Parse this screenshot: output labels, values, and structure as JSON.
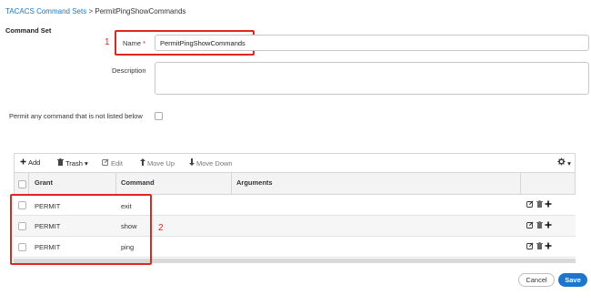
{
  "breadcrumb": {
    "link": "TACACS Command Sets",
    "separator": ">",
    "current": "PermitPingShowCommands"
  },
  "section_title": "Command Set",
  "annotations": {
    "first": "1",
    "second": "2"
  },
  "form": {
    "name_label": "Name",
    "required_mark": "*",
    "name_value": "PermitPingShowCommands",
    "description_label": "Description",
    "description_value": "",
    "permit_label": "Permit any command that is not listed below",
    "permit_checked": false
  },
  "toolbar": {
    "add": "Add",
    "trash": "Trash",
    "edit": "Edit",
    "move_up": "Move Up",
    "move_down": "Move Down"
  },
  "table": {
    "columns": [
      "Grant",
      "Command",
      "Arguments"
    ],
    "rows": [
      {
        "grant": "PERMIT",
        "command": "exit",
        "arguments": ""
      },
      {
        "grant": "PERMIT",
        "command": "show",
        "arguments": ""
      },
      {
        "grant": "PERMIT",
        "command": "ping",
        "arguments": ""
      }
    ]
  },
  "buttons": {
    "cancel": "Cancel",
    "save": "Save"
  },
  "colors": {
    "accent": "#1f75cc",
    "link": "#1f75b8",
    "annotation": "#e0261f"
  }
}
